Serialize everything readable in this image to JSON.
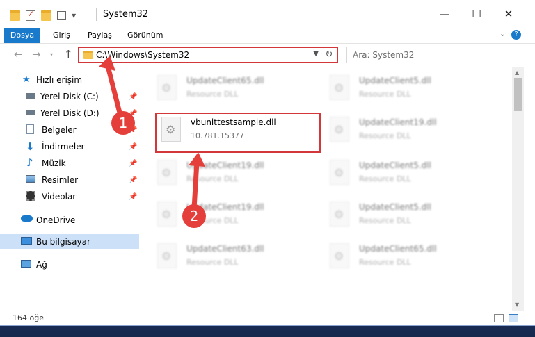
{
  "window": {
    "title": "System32"
  },
  "window_controls": {
    "minimize": "—",
    "maximize": "☐",
    "close": "✕"
  },
  "ribbon": {
    "tabs": [
      "Dosya",
      "Giriş",
      "Paylaş",
      "Görünüm"
    ],
    "help": "?"
  },
  "address_bar": {
    "path": "C:\\Windows\\System32"
  },
  "search": {
    "placeholder": "Ara: System32"
  },
  "nav": {
    "items": [
      {
        "label": "Hızlı erişim",
        "icon": "star-icon"
      },
      {
        "label": "Yerel Disk (C:)",
        "icon": "drive-icon"
      },
      {
        "label": "Yerel Disk (D:)",
        "icon": "drive-icon"
      },
      {
        "label": "Belgeler",
        "icon": "documents-icon"
      },
      {
        "label": "İndirmeler",
        "icon": "download-icon"
      },
      {
        "label": "Müzik",
        "icon": "music-icon"
      },
      {
        "label": "Resimler",
        "icon": "pictures-icon"
      },
      {
        "label": "Videolar",
        "icon": "video-icon"
      },
      {
        "label": "OneDrive",
        "icon": "cloud-icon"
      },
      {
        "label": "Bu bilgisayar",
        "icon": "computer-icon"
      },
      {
        "label": "Ağ",
        "icon": "network-icon"
      }
    ]
  },
  "files": [
    {
      "name": "UpdateClient65.dll",
      "sub": "Resource DLL"
    },
    {
      "name": "UpdateClient5.dll",
      "sub": "Resource DLL"
    },
    {
      "name": "vbunittestsample.dll",
      "sub": "10.781.15377"
    },
    {
      "name": "UpdateClient19.dll",
      "sub": "Resource DLL"
    },
    {
      "name": "UpdateClient19.dll",
      "sub": "Resource DLL"
    },
    {
      "name": "UpdateClient5.dll",
      "sub": "Resource DLL"
    },
    {
      "name": "UpdateClient19.dll",
      "sub": "Resource DLL"
    },
    {
      "name": "UpdateClient5.dll",
      "sub": "Resource DLL"
    },
    {
      "name": "UpdateClient63.dll",
      "sub": "Resource DLL"
    },
    {
      "name": "UpdateClient65.dll",
      "sub": "Resource DLL"
    }
  ],
  "status": {
    "count": "164 öğe"
  },
  "annotations": [
    "1",
    "2"
  ],
  "colors": {
    "accent": "#1979ca",
    "highlight": "#d4373a",
    "arrow": "#e53f3c"
  }
}
